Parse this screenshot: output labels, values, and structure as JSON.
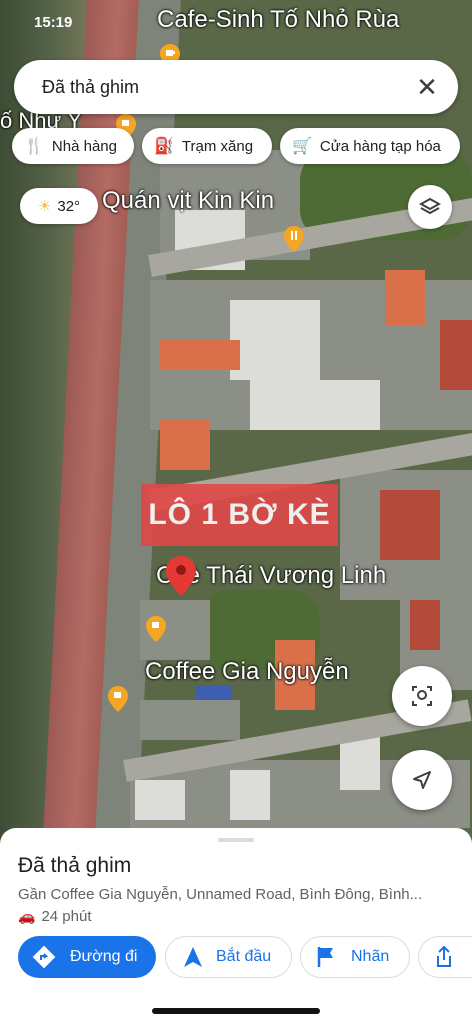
{
  "status_bar": {
    "time": "15:19"
  },
  "search": {
    "query": "Đã thả ghim"
  },
  "chips": [
    {
      "icon": "restaurant-icon",
      "label": "Nhà hàng"
    },
    {
      "icon": "gas-station-icon",
      "label": "Trạm xăng"
    },
    {
      "icon": "cart-icon",
      "label": "Cửa hàng tạp hóa"
    }
  ],
  "weather": {
    "temp": "32°"
  },
  "map_labels": {
    "top_cafe": "Cafe-Sinh Tố Nhỏ Rùa",
    "left_cut": "ố Như Ý",
    "duck": "Quán vịt Kin Kin",
    "banner": "LÔ 1 BỜ KÈ",
    "che": "Chè Thái Vương Linh",
    "coffee": "Coffee Gia Nguyễn"
  },
  "sheet": {
    "title": "Đã thả ghim",
    "address": "Gần Coffee Gia Nguyễn, Unnamed Road, Bình Đông, Bình...",
    "drive_time": "24 phút",
    "buttons": {
      "directions": "Đường đi",
      "start": "Bắt đầu",
      "label": "Nhãn"
    }
  },
  "colors": {
    "accent": "#1a73e8",
    "banner": "#e14848",
    "pin": "#e53935",
    "food_pin": "#f5a623"
  }
}
